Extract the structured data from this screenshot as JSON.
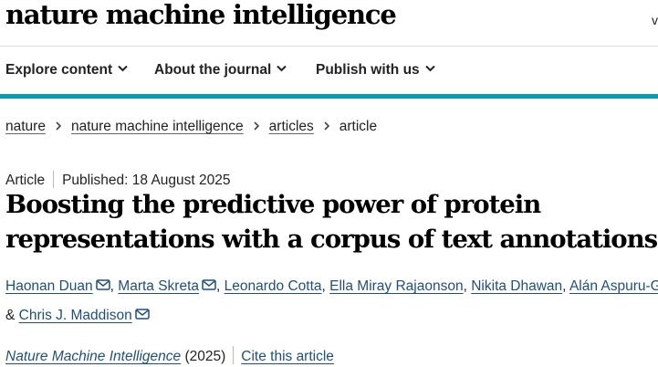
{
  "header": {
    "logo_text": "nature machine intelligence",
    "edge_char": "v"
  },
  "nav": {
    "items": [
      {
        "label": "Explore content"
      },
      {
        "label": "About the journal"
      },
      {
        "label": "Publish with us"
      }
    ],
    "accent_color": "#069bb5"
  },
  "breadcrumb": {
    "items": [
      "nature",
      "nature machine intelligence",
      "articles"
    ],
    "current": "article"
  },
  "article": {
    "type": "Article",
    "published": "Published: 18 August 2025",
    "title": "Boosting the predictive power of protein representations with a corpus of text annotations",
    "authors": [
      {
        "name": "Haonan Duan",
        "email_icon": true
      },
      {
        "name": "Marta Skreta",
        "email_icon": true
      },
      {
        "name": "Leonardo Cotta",
        "email_icon": false
      },
      {
        "name": "Ella Miray Rajaonson",
        "email_icon": false
      },
      {
        "name": "Nikita Dhawan",
        "email_icon": false
      },
      {
        "name": "Alán Aspuru-Guzik",
        "email_icon": false
      },
      {
        "name": "Chris J. Maddison",
        "email_icon": true
      }
    ],
    "separator": ",",
    "final_conjunction": "&",
    "journal": "Nature Machine Intelligence",
    "year": "(2025)",
    "cite_label": "Cite this article"
  }
}
